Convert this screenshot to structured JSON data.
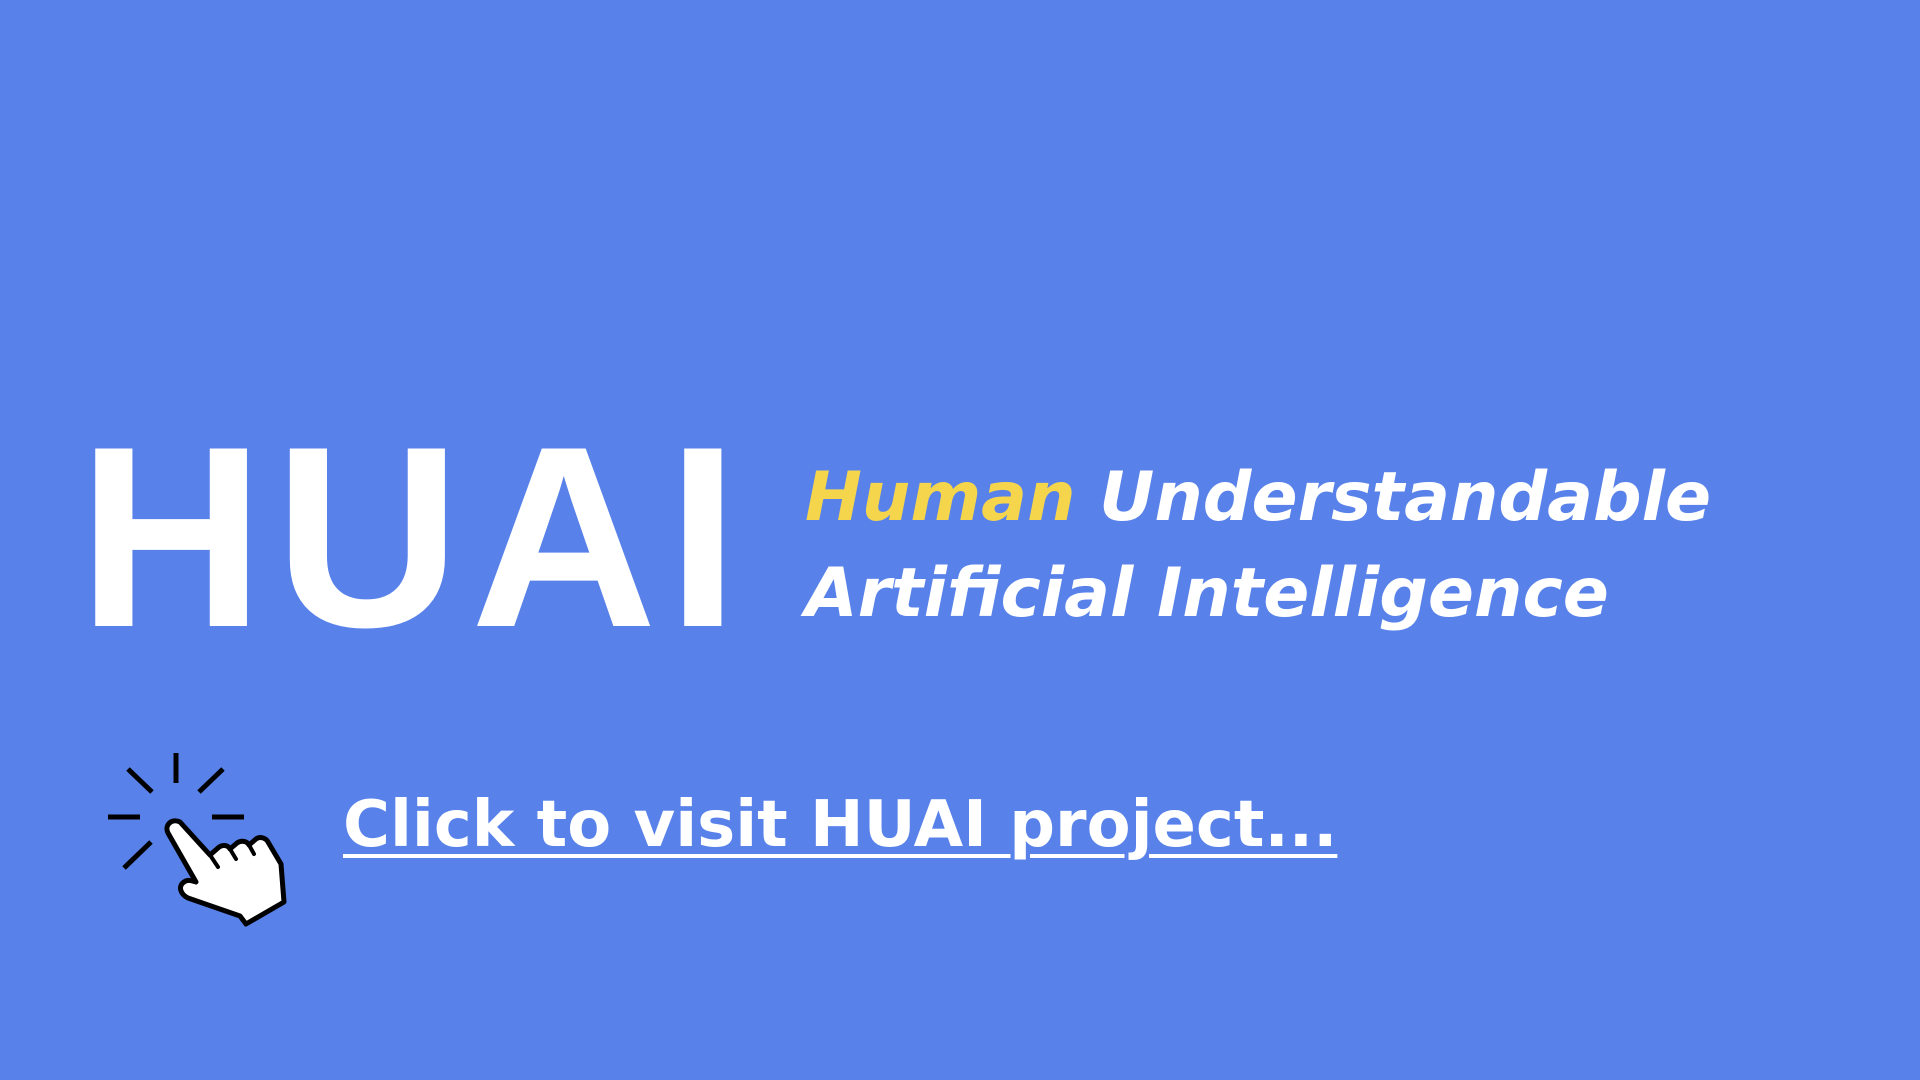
{
  "logo": {
    "text": "HUAI"
  },
  "tagline": {
    "word_highlight": "Human",
    "word_rest_line1": "Understandable",
    "line2": "Artificial Intelligence"
  },
  "cta": {
    "label": "Click to visit HUAI project...",
    "icon": "pointing-hand-click-icon"
  },
  "colors": {
    "background": "#5882EA",
    "text": "#FFFFFF",
    "accent": "#F5D54C"
  }
}
